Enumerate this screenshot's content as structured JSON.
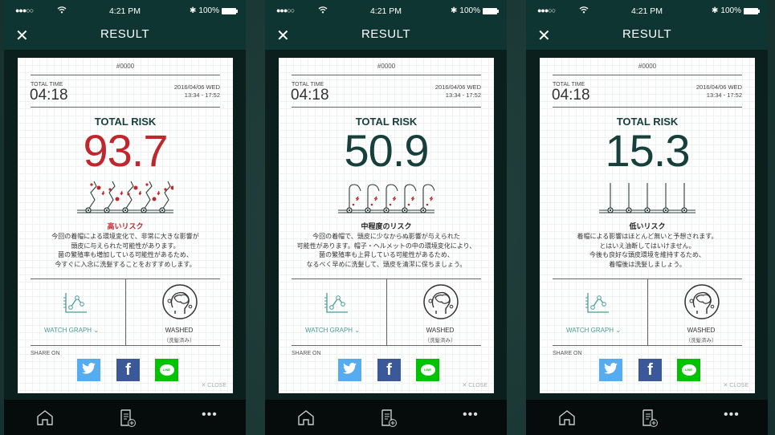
{
  "status": {
    "time": "4:21 PM",
    "battery": "100%"
  },
  "header": {
    "title": "RESULT"
  },
  "colors": {
    "high": "#c0272d",
    "normal": "#17403c",
    "accent": "#4a9a96",
    "twitter": "#55acee",
    "facebook": "#3b5998",
    "line": "#00c300"
  },
  "panels": [
    {
      "id": "#0000",
      "total_time_label": "TOTAL TIME",
      "total_time": "04:18",
      "date": "2016/04/06 WED",
      "range": "13:34 - 17:52",
      "total_risk_label": "TOTAL RISK",
      "risk_value": "93.7",
      "level": "high",
      "level_label": "高いリスク",
      "desc": [
        "今回の着帽による環境変化で、非常に大きな影響が",
        "頭皮に与えられた可能性があります。",
        "菌の繁殖率も増加している可能性があるため、",
        "今すぐに入念に洗髪することをおすすめします。"
      ],
      "watch_graph": "WATCH GRAPH",
      "washed": "WASHED",
      "washed_sub": "（洗髪済み）",
      "share_on": "SHARE ON",
      "close": "✕ CLOSE"
    },
    {
      "id": "#0000",
      "total_time_label": "TOTAL TIME",
      "total_time": "04:18",
      "date": "2016/04/06 WED",
      "range": "13:34 - 17:52",
      "total_risk_label": "TOTAL RISK",
      "risk_value": "50.9",
      "level": "medium",
      "level_label": "中程度のリスク",
      "desc": [
        "今回の着帽で、頭皮に少なからぬ影響が与えられた",
        "可能性があります。帽子・ヘルメットの中の環境変化により、",
        "菌の繁殖率も上昇している可能性があるため、",
        "なるべく早めに洗髪して、頭皮を清潔に保ちましょう。"
      ],
      "watch_graph": "WATCH GRAPH",
      "washed": "WASHED",
      "washed_sub": "（洗髪済み）",
      "share_on": "SHARE ON",
      "close": "✕ CLOSE"
    },
    {
      "id": "#0000",
      "total_time_label": "TOTAL TIME",
      "total_time": "04:18",
      "date": "2016/04/06 WED",
      "range": "13:34 - 17:52",
      "total_risk_label": "TOTAL RISK",
      "risk_value": "15.3",
      "level": "low",
      "level_label": "低いリスク",
      "desc": [
        "着帽による影響はほとんど無いと予想されます。",
        "とはいえ油断してはいけません。",
        "今後も良好な頭皮環境を維持するため、",
        "着帽後は洗髪しましょう。"
      ],
      "watch_graph": "WATCH GRAPH",
      "washed": "WASHED",
      "washed_sub": "（洗髪済み）",
      "share_on": "SHARE ON",
      "close": "✕ CLOSE"
    }
  ]
}
